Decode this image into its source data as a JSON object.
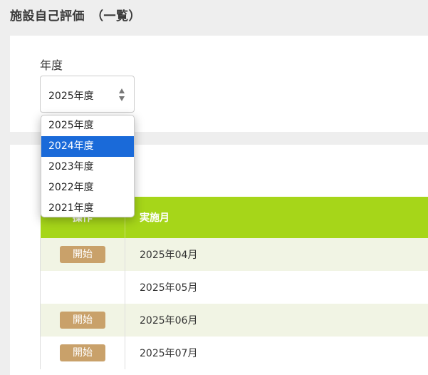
{
  "page": {
    "title": "施設自己評価　（一覧）"
  },
  "filter": {
    "label": "年度",
    "selected_value": "2025年度",
    "options": [
      "2025年度",
      "2024年度",
      "2023年度",
      "2022年度",
      "2021年度"
    ],
    "highlighted_option": "2024年度"
  },
  "table": {
    "headers": {
      "operation": "操作",
      "month": "実施月"
    },
    "rows": [
      {
        "action": "開始",
        "month": "2025年04月"
      },
      {
        "action": "",
        "month": "2025年05月"
      },
      {
        "action": "開始",
        "month": "2025年06月"
      },
      {
        "action": "開始",
        "month": "2025年07月"
      }
    ]
  },
  "colors": {
    "header_green": "#a6d619",
    "button_tan": "#c9a16a",
    "selection_blue": "#1a6ad9",
    "row_shade": "#f1f4e4"
  }
}
